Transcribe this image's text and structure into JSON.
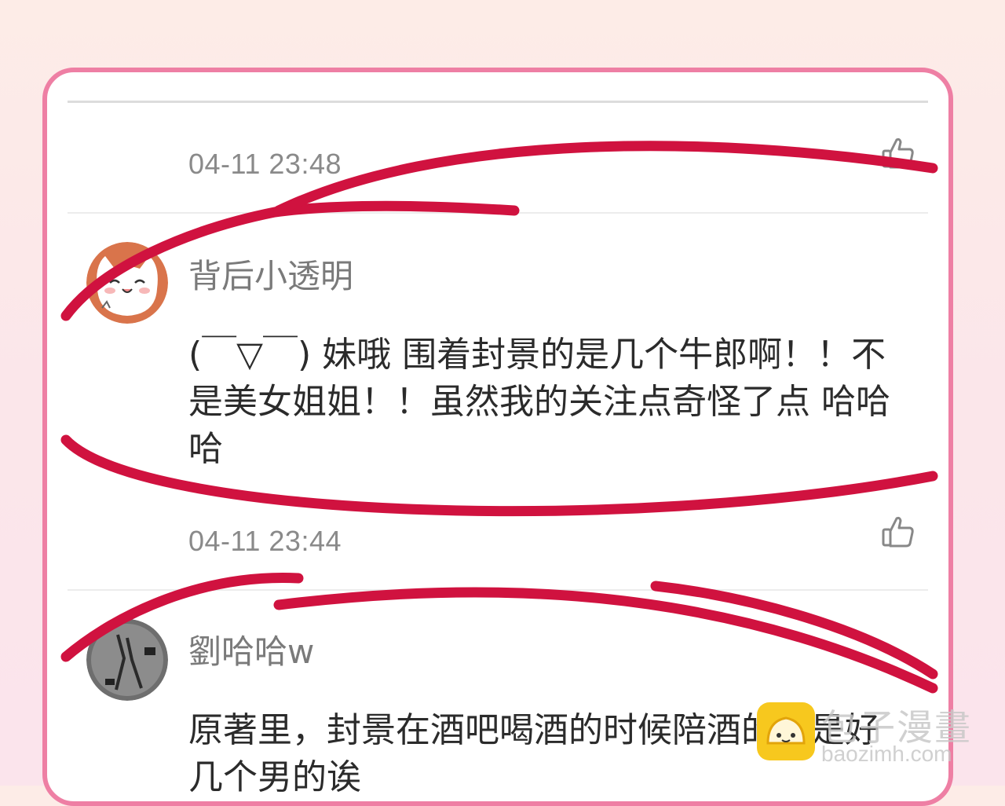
{
  "comments": [
    {
      "time": "04-11 23:48",
      "like_icon": "thumbs-up-icon"
    },
    {
      "username": "背后小透明",
      "avatar_icon": "cat-avatar",
      "text": "(￣▽￣) 妹哦 围着封景的是几个牛郎啊！！不是美女姐姐！！虽然我的关注点奇怪了点 哈哈哈",
      "time": "04-11 23:44",
      "like_icon": "thumbs-up-icon"
    },
    {
      "username": "劉哈哈w",
      "avatar_icon": "sketch-avatar",
      "text": "原著里，封景在酒吧喝酒的时候陪酒的可是好几个男的诶"
    }
  ],
  "annotation": {
    "color": "#d0123f"
  },
  "watermark": {
    "text": "包子漫畫",
    "url": "baozimh.com"
  },
  "colors": {
    "card_border": "#ee7fa4",
    "annotation": "#d0123f"
  }
}
